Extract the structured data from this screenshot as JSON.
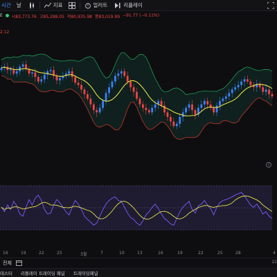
{
  "toolbar": {
    "interval_label": "시간",
    "interval_value": "날",
    "indicators_label": "지표",
    "alert_label": "얼러트",
    "replay_label": "리플레이"
  },
  "legend": {
    "ohlc_open": "시83,773.76",
    "ohlc_high": "고85,288.05",
    "ohlc_low": "저80,935.98",
    "ohlc_close": "종83,019.99",
    "ohlc_change": "−91.77 (−0.11%)",
    "symbol_fragment": "E",
    "sub_value": "2.12"
  },
  "xaxis": {
    "labels": [
      "16",
      "19",
      "22",
      "25",
      "3월",
      "7",
      "10",
      "13",
      "16",
      "19",
      "22",
      "25",
      "28"
    ],
    "edge_right": "4"
  },
  "range": {
    "all_label": "전체",
    "corner_value": "22"
  },
  "bottom_tabs": [
    "테스터",
    "리플레이 트레이딩 패널",
    "트레이딩패널"
  ],
  "colors": {
    "up": "#3b82f6",
    "down": "#ef4444",
    "bb_upper": "#1f9a57",
    "bb_lower": "#c0392b",
    "basis": "#e6e04a",
    "fill": "#10302a",
    "rsi": "#7c5cff",
    "rsi_ma": "#e6e04a",
    "rsi_band": "#24203a"
  },
  "chart_data": {
    "type": "candlestick",
    "price_series_close": [
      0.23,
      0.22,
      0.25,
      0.24,
      0.28,
      0.26,
      0.22,
      0.2,
      0.24,
      0.28,
      0.27,
      0.31,
      0.35,
      0.33,
      0.29,
      0.26,
      0.25,
      0.3,
      0.34,
      0.32,
      0.3,
      0.28,
      0.26,
      0.31,
      0.36,
      0.38,
      0.42,
      0.46,
      0.5,
      0.55,
      0.6,
      0.62,
      0.58,
      0.52,
      0.45,
      0.4,
      0.35,
      0.3,
      0.28,
      0.26,
      0.3,
      0.35,
      0.4,
      0.44,
      0.5,
      0.55,
      0.58,
      0.6,
      0.62,
      0.58,
      0.55,
      0.52,
      0.56,
      0.62,
      0.66,
      0.7,
      0.74,
      0.72,
      0.66,
      0.62,
      0.58,
      0.55,
      0.6,
      0.64,
      0.58,
      0.55,
      0.52,
      0.55,
      0.58,
      0.62,
      0.56,
      0.52,
      0.5,
      0.48,
      0.45,
      0.42,
      0.4,
      0.38,
      0.35,
      0.33,
      0.35,
      0.38,
      0.4,
      0.37,
      0.4,
      0.44,
      0.42,
      0.46,
      0.48
    ],
    "rsi_series": [
      0.55,
      0.45,
      0.6,
      0.5,
      0.68,
      0.58,
      0.4,
      0.35,
      0.55,
      0.72,
      0.6,
      0.75,
      0.82,
      0.7,
      0.5,
      0.4,
      0.42,
      0.6,
      0.72,
      0.65,
      0.55,
      0.45,
      0.38,
      0.55,
      0.7,
      0.62,
      0.5,
      0.35,
      0.28,
      0.22,
      0.15,
      0.2,
      0.35,
      0.5,
      0.62,
      0.7,
      0.75,
      0.78,
      0.7,
      0.68,
      0.55,
      0.42,
      0.32,
      0.28,
      0.2,
      0.15,
      0.25,
      0.38,
      0.45,
      0.55,
      0.62,
      0.52,
      0.4,
      0.3,
      0.25,
      0.18,
      0.15,
      0.3,
      0.45,
      0.55,
      0.62,
      0.68,
      0.5,
      0.42,
      0.58,
      0.62,
      0.7,
      0.6,
      0.52,
      0.38,
      0.55,
      0.65,
      0.7,
      0.72,
      0.75,
      0.78,
      0.82,
      0.85,
      0.88,
      0.8,
      0.7,
      0.6,
      0.55,
      0.62,
      0.52,
      0.4,
      0.45,
      0.35,
      0.3
    ]
  }
}
